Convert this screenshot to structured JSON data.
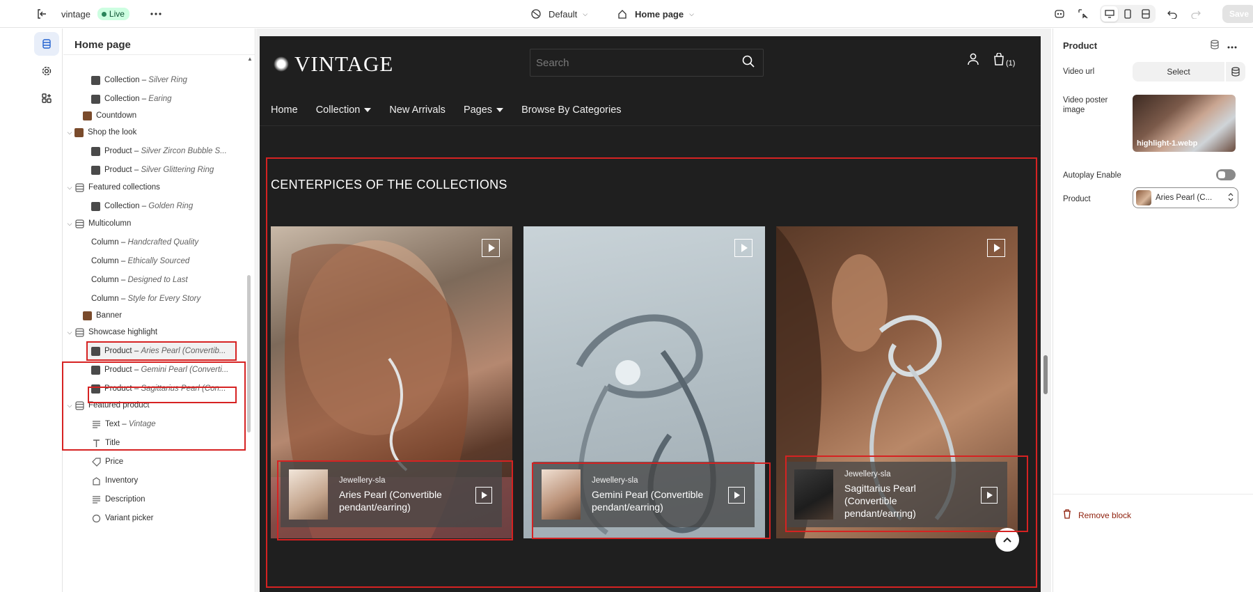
{
  "topbar": {
    "store_name": "vintage",
    "status_badge": "Live",
    "theme_select": "Default",
    "page_select": "Home page",
    "save_label": "Save"
  },
  "sidebar": {
    "title": "Home page",
    "nodes": [
      {
        "label": "Collection",
        "sub": "Silver Ring"
      },
      {
        "label": "Collection",
        "sub": "Earing"
      },
      {
        "label": "Countdown",
        "sub": ""
      },
      {
        "label": "Shop the look",
        "sub": ""
      },
      {
        "label": "Product",
        "sub": "Silver Zircon Bubble S..."
      },
      {
        "label": "Product",
        "sub": "Silver Glittering Ring"
      },
      {
        "label": "Featured collections",
        "sub": ""
      },
      {
        "label": "Collection",
        "sub": "Golden Ring"
      },
      {
        "label": "Multicolumn",
        "sub": ""
      },
      {
        "label": "Column",
        "sub": "Handcrafted Quality"
      },
      {
        "label": "Column",
        "sub": "Ethically Sourced"
      },
      {
        "label": "Column",
        "sub": "Designed to Last"
      },
      {
        "label": "Column",
        "sub": "Style for Every Story"
      },
      {
        "label": "Banner",
        "sub": ""
      },
      {
        "label": "Showcase highlight",
        "sub": ""
      },
      {
        "label": "Product",
        "sub": "Aries Pearl (Convertib..."
      },
      {
        "label": "Product",
        "sub": "Gemini Pearl (Converti..."
      },
      {
        "label": "Product",
        "sub": "Sagittarius Pearl (Con..."
      },
      {
        "label": "Featured product",
        "sub": ""
      },
      {
        "label": "Text",
        "sub": "Vintage"
      },
      {
        "label": "Title",
        "sub": ""
      },
      {
        "label": "Price",
        "sub": ""
      },
      {
        "label": "Inventory",
        "sub": ""
      },
      {
        "label": "Description",
        "sub": ""
      },
      {
        "label": "Variant picker",
        "sub": ""
      }
    ],
    "separator": " – "
  },
  "store": {
    "logo": "VINTAGE",
    "search_placeholder": "Search",
    "cart_count": "(1)",
    "nav": [
      "Home",
      "Collection",
      "New Arrivals",
      "Pages",
      "Browse By Categories"
    ],
    "section_title": "CENTERPICES OF THE COLLECTIONS",
    "cards": [
      {
        "vendor": "Jewellery-sla",
        "name": "Aries Pearl (Convertible pendant/earring)"
      },
      {
        "vendor": "Jewellery-sla",
        "name": "Gemini Pearl (Convertible pendant/earring)"
      },
      {
        "vendor": "Jewellery-sla",
        "name": "Sagittarius Pearl (Convertible pendant/earring)"
      }
    ]
  },
  "panel": {
    "title": "Product",
    "video_url_label": "Video url",
    "select_label": "Select",
    "poster_label": "Video poster image",
    "poster_file": "highlight-1.webp",
    "autoplay_label": "Autoplay Enable",
    "autoplay_enabled": false,
    "product_label": "Product",
    "product_value": "Aries Pearl (C...",
    "remove_label": "Remove block"
  },
  "colors": {
    "accent_red": "#d62222",
    "store_bg": "#1f1f1f",
    "live_bg": "#cdfee1"
  }
}
